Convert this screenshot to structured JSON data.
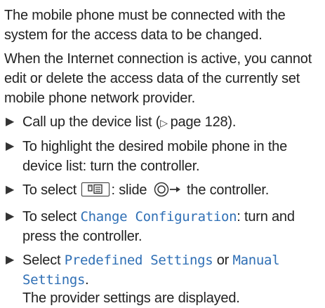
{
  "paragraphs": [
    "The mobile phone must be connected with the system for the access data to be changed.",
    "When the Internet connection is active, you cannot edit or delete the access data of the currently set mobile phone network provider."
  ],
  "steps": {
    "s1_before": "Call up the device list (",
    "s1_ref": "page 128",
    "s1_after": ").",
    "s2": "To highlight the desired mobile phone in the device list: turn the controller.",
    "s3_before": "To select ",
    "s3_mid": ": slide ",
    "s3_after": " the controller.",
    "s4_before": "To select ",
    "s4_menu": "Change Configuration",
    "s4_after": ": turn and press the controller.",
    "s5_before": "Select ",
    "s5_menu1": "Predefined Settings",
    "s5_mid": " or ",
    "s5_menu2": "Manual Settings",
    "s5_after": ".",
    "s5_result": "The provider settings are displayed."
  },
  "icons": {
    "bullet": "right-pointing-triangle",
    "reference": "reference-arrow-icon",
    "phone_menu": "phone-menu-icon",
    "controller_slide": "controller-slide-right-icon"
  },
  "colors": {
    "text": "#222222",
    "menu_text": "#2f6fb5"
  }
}
